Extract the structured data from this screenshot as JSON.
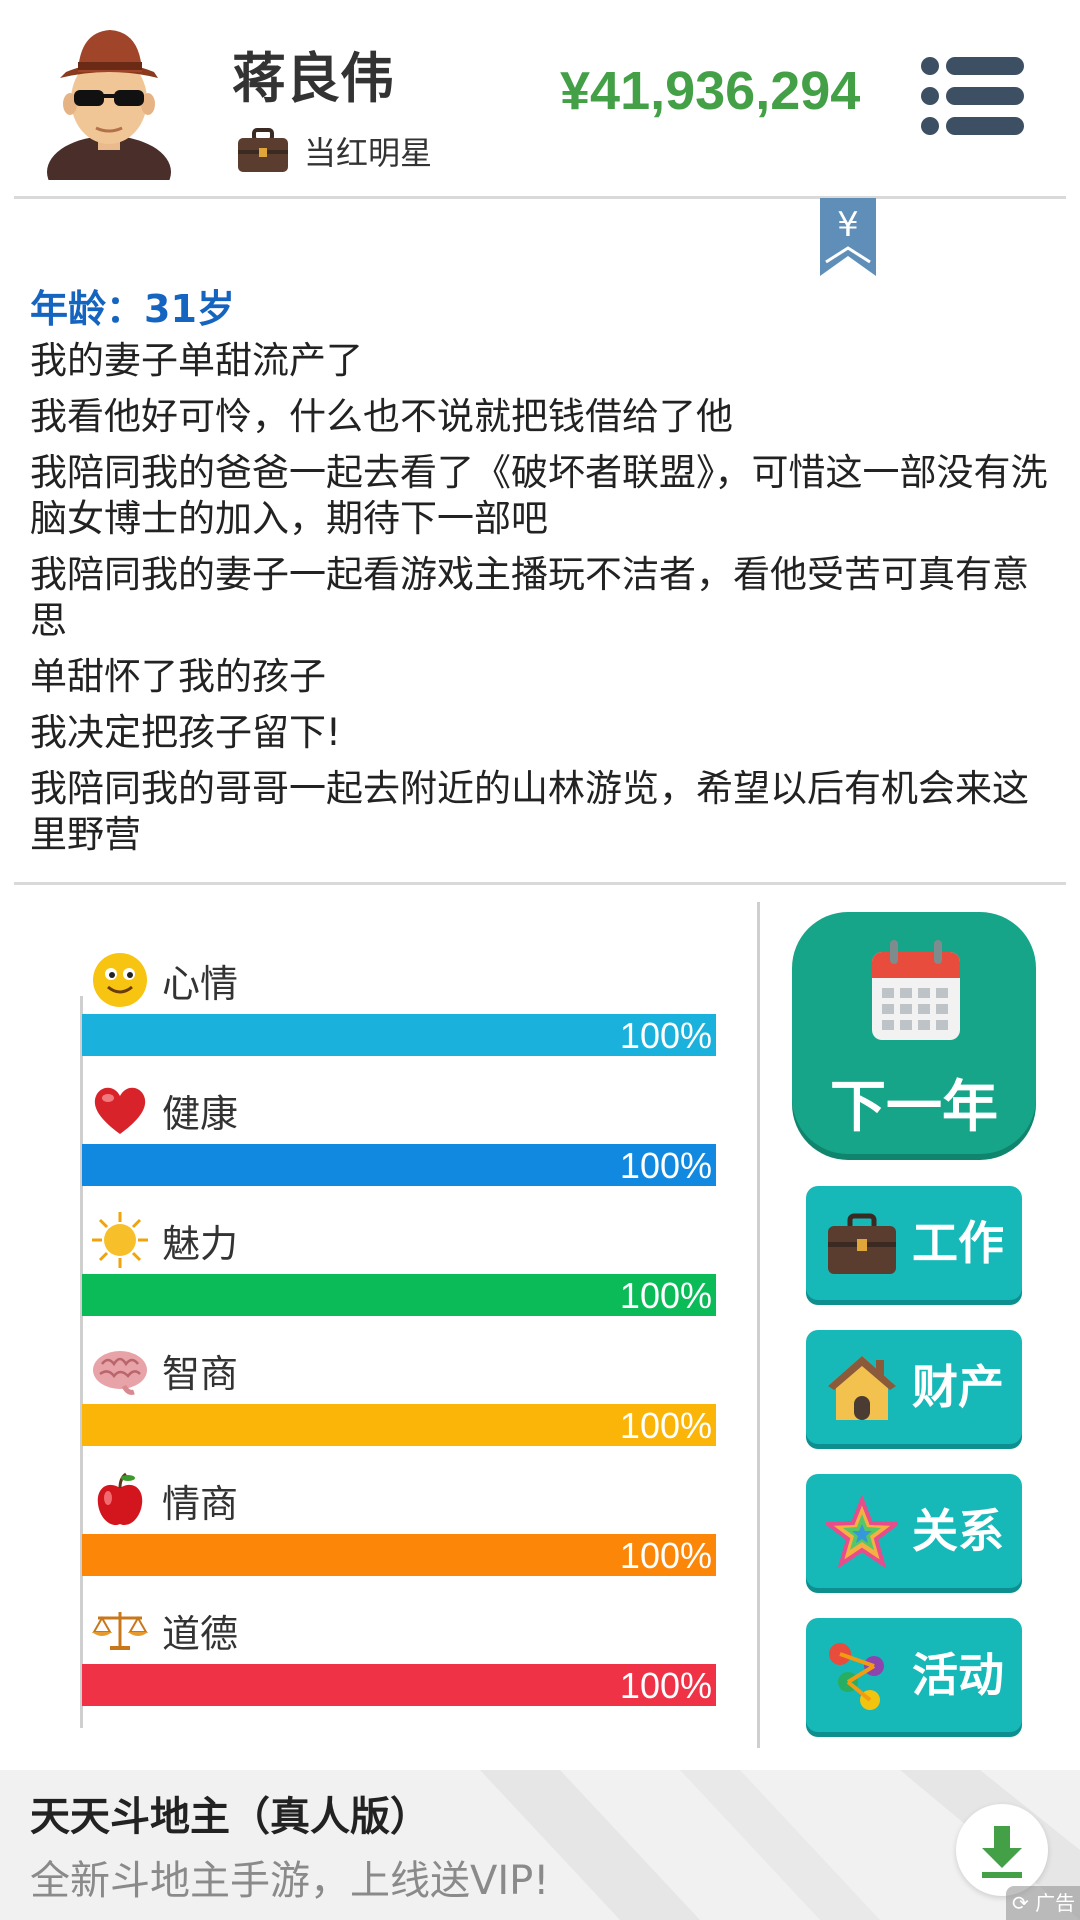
{
  "header": {
    "name": "蒋良伟",
    "job": "当红明星",
    "money": "¥41,936,294"
  },
  "log": {
    "age": "年龄：31岁",
    "lines": [
      "我的妻子单甜流产了",
      "我看他好可怜，什么也不说就把钱借给了他",
      "我陪同我的爸爸一起去看了《破坏者联盟》，可惜这一部没有洗脑女博士的加入，期待下一部吧",
      "我陪同我的妻子一起看游戏主播玩不洁者，看他受苦可真有意思",
      "单甜怀了我的孩子",
      "我决定把孩子留下!",
      "我陪同我的哥哥一起去附近的山林游览，希望以后有机会来这里野营"
    ]
  },
  "stats": [
    {
      "label": "心情",
      "value": 100,
      "text": "100%",
      "color": "#1ab1dc",
      "icon": "smiley-icon"
    },
    {
      "label": "健康",
      "value": 100,
      "text": "100%",
      "color": "#1289e0",
      "icon": "heart-icon"
    },
    {
      "label": "魅力",
      "value": 100,
      "text": "100%",
      "color": "#0bbb58",
      "icon": "sun-icon"
    },
    {
      "label": "智商",
      "value": 100,
      "text": "100%",
      "color": "#fbb508",
      "icon": "brain-icon"
    },
    {
      "label": "情商",
      "value": 100,
      "text": "100%",
      "color": "#fb8608",
      "icon": "apple-icon"
    },
    {
      "label": "道德",
      "value": 100,
      "text": "100%",
      "color": "#ef3245",
      "icon": "scales-icon"
    }
  ],
  "buttons": {
    "next_year": "下一年",
    "work": "工作",
    "property": "财产",
    "relations": "关系",
    "activities": "活动"
  },
  "ad": {
    "title": "天天斗地主（真人版）",
    "subtitle": "全新斗地主手游，上线送VIP!",
    "tag": "广告"
  }
}
